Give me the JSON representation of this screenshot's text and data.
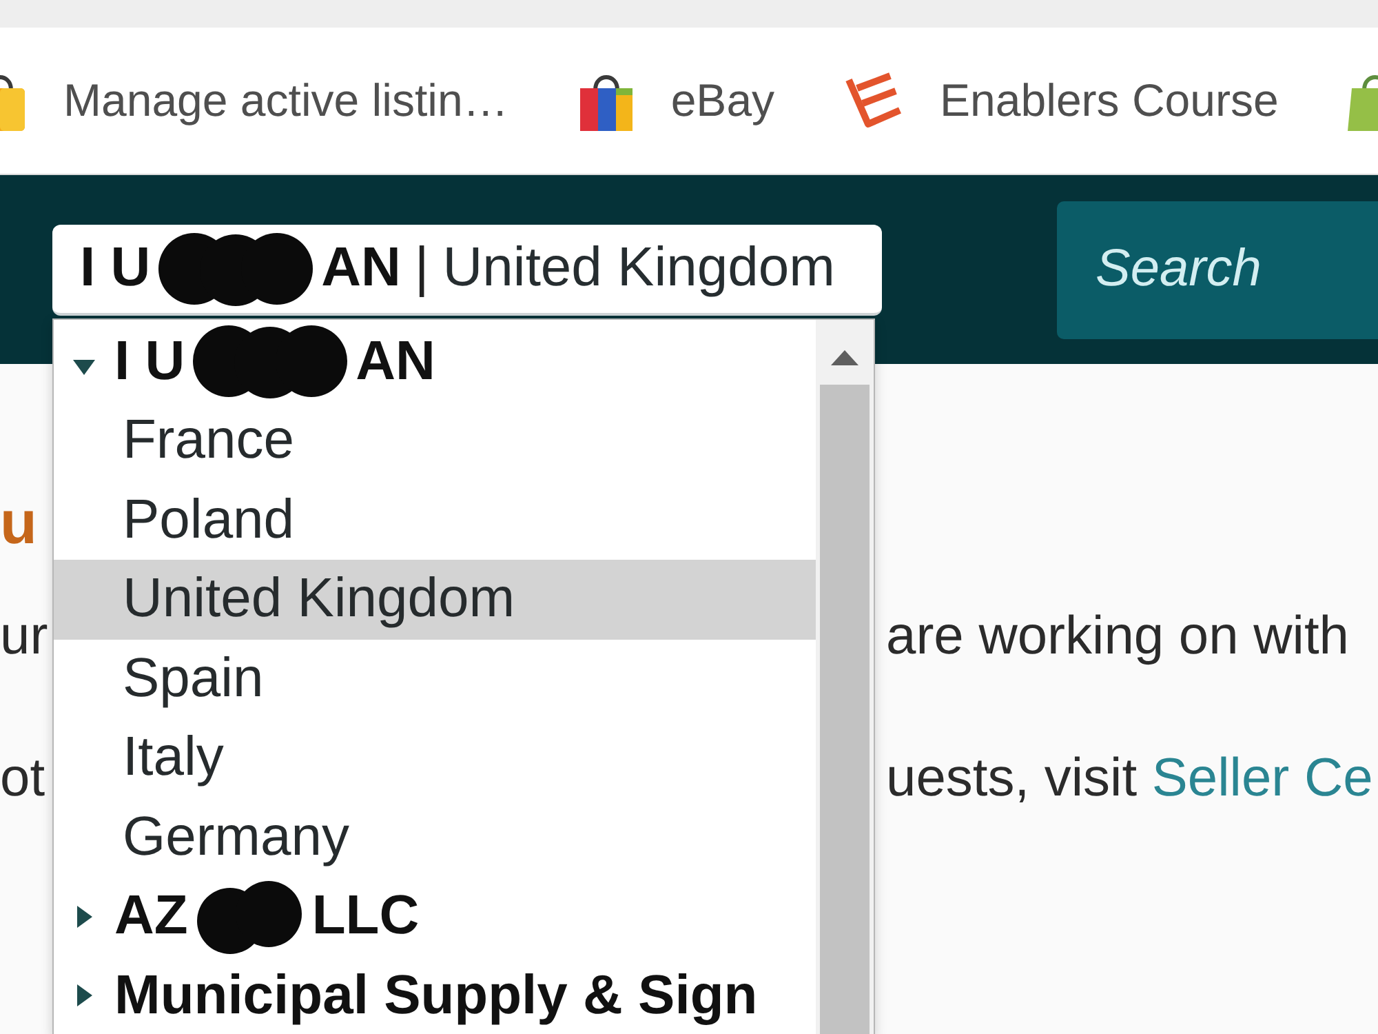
{
  "bookmarks_bar": {
    "items": [
      {
        "label": "Manage active listin…"
      },
      {
        "label": "eBay"
      },
      {
        "label": "Enablers Course"
      }
    ]
  },
  "header": {
    "account_select": {
      "name": [
        {
          "kind": "text",
          "text": "I U"
        },
        {
          "kind": "redacted"
        },
        {
          "kind": "text",
          "text": "AN"
        }
      ],
      "separator": "|",
      "marketplace": "United Kingdom"
    },
    "search_button": {
      "label": "Search"
    }
  },
  "dropdown": {
    "groups": [
      {
        "name": [
          {
            "kind": "text",
            "text": "I U"
          },
          {
            "kind": "redacted"
          },
          {
            "kind": "text",
            "text": "AN"
          }
        ],
        "expanded": true,
        "children": [
          {
            "label": "France",
            "selected": false
          },
          {
            "label": "Poland",
            "selected": false
          },
          {
            "label": "United Kingdom",
            "selected": true
          },
          {
            "label": "Spain",
            "selected": false
          },
          {
            "label": "Italy",
            "selected": false
          },
          {
            "label": "Germany",
            "selected": false
          }
        ]
      },
      {
        "name": [
          {
            "kind": "text",
            "text": "AZ"
          },
          {
            "kind": "redacted"
          },
          {
            "kind": "text",
            "text": "LLC"
          }
        ],
        "expanded": false
      },
      {
        "name": [
          {
            "kind": "text",
            "text": "Municipal Supply & Sign"
          }
        ],
        "expanded": false
      }
    ]
  },
  "page": {
    "heading_fragment": "u",
    "lines": [
      {
        "left": "ur",
        "right": "are working on with"
      },
      {
        "left": "ot",
        "right": "uests, visit",
        "link": "Seller Ce"
      }
    ]
  }
}
